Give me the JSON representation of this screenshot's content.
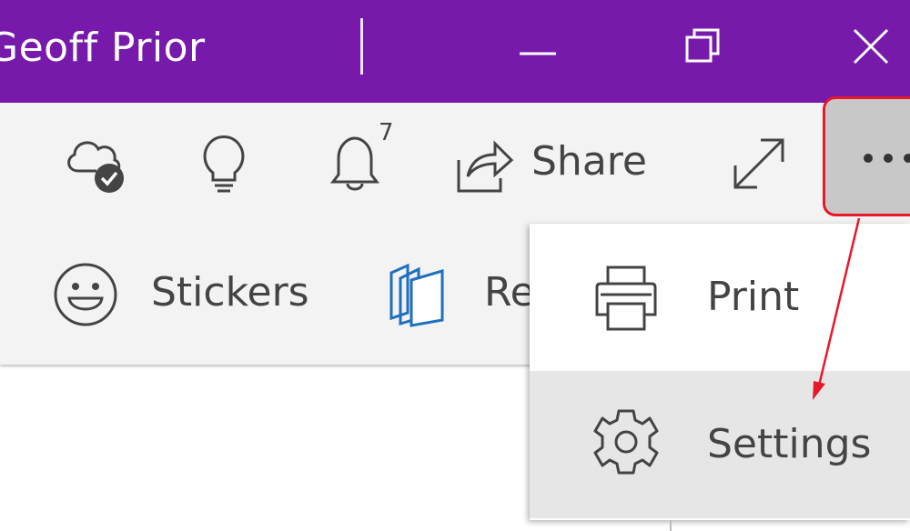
{
  "titlebar": {
    "user_name": "Geoff Prior",
    "background": "#7719aa",
    "buttons": [
      "minimize-icon",
      "restore-icon",
      "close-icon"
    ]
  },
  "toolbar": {
    "notifications_count": "7",
    "share_label": "Share",
    "stickers_label": "Stickers",
    "partial_label": "Re",
    "icons": [
      "cloud-sync-check-icon",
      "lightbulb-icon",
      "bell-icon",
      "share-icon",
      "expand-icon",
      "more-options-icon",
      "smiley-icon",
      "pages-icon"
    ]
  },
  "menu": {
    "items": [
      {
        "label": "Print",
        "icon": "printer-icon"
      },
      {
        "label": "Settings",
        "icon": "gear-icon",
        "highlighted": true
      }
    ]
  },
  "annotation": {
    "color": "#e8182b"
  }
}
